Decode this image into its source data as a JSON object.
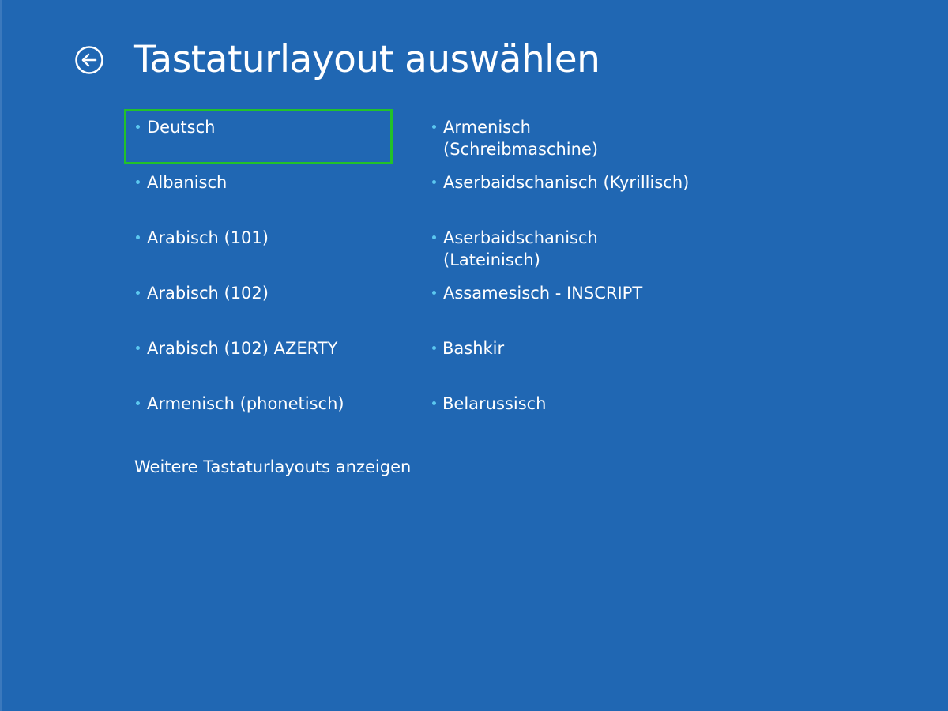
{
  "page": {
    "title": "Tastaturlayout auswählen",
    "back_icon": "circle-arrow-left-icon",
    "background_color": "#2067b3",
    "selection_color": "#22c22a",
    "bullet_color": "#5cc8f0"
  },
  "layouts": {
    "left_column": [
      {
        "label": "Deutsch",
        "selected": true
      },
      {
        "label": "Albanisch",
        "selected": false
      },
      {
        "label": "Arabisch (101)",
        "selected": false
      },
      {
        "label": "Arabisch (102)",
        "selected": false
      },
      {
        "label": "Arabisch (102) AZERTY",
        "selected": false
      },
      {
        "label": "Armenisch (phonetisch)",
        "selected": false
      }
    ],
    "right_column": [
      {
        "label_line1": "Armenisch",
        "label_line2": "(Schreibmaschine)",
        "selected": false
      },
      {
        "label_line1": "Aserbaidschanisch (Kyrillisch)",
        "label_line2": "",
        "selected": false
      },
      {
        "label_line1": "Aserbaidschanisch",
        "label_line2": "(Lateinisch)",
        "selected": false
      },
      {
        "label_line1": "Assamesisch - INSCRIPT",
        "label_line2": "",
        "selected": false
      },
      {
        "label_line1": "Bashkir",
        "label_line2": "",
        "selected": false
      },
      {
        "label_line1": "Belarussisch",
        "label_line2": "",
        "selected": false
      }
    ]
  },
  "more_link": {
    "label": "Weitere Tastaturlayouts anzeigen"
  }
}
